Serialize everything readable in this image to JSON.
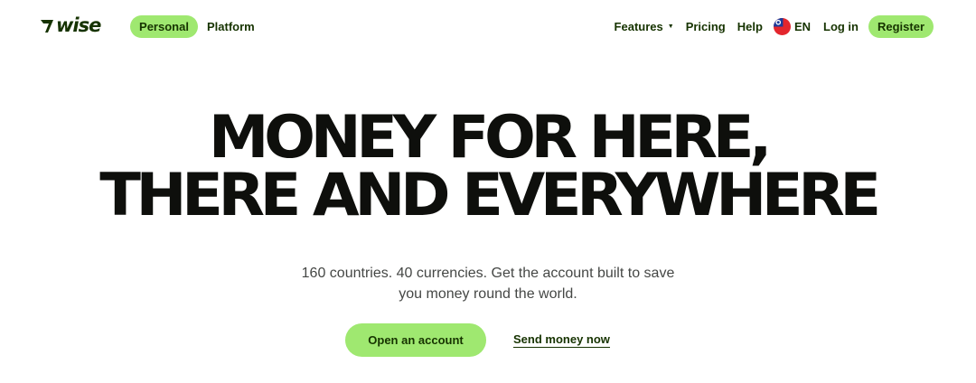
{
  "brand": {
    "logo_text": "wise"
  },
  "nav": {
    "tabs": [
      {
        "label": "Personal",
        "active": true
      },
      {
        "label": "Platform",
        "active": false
      }
    ],
    "features_label": "Features",
    "pricing_label": "Pricing",
    "help_label": "Help",
    "language_code": "EN",
    "login_label": "Log in",
    "register_label": "Register"
  },
  "hero": {
    "headline_line1": "MONEY FOR HERE,",
    "headline_line2": "THERE AND EVERYWHERE",
    "sub_line1": "160 countries. 40 currencies. Get the account built to save",
    "sub_line2": "you money round the world.",
    "primary_cta": "Open an account",
    "secondary_cta": "Send money now"
  },
  "colors": {
    "accent": "#9fe870",
    "brand_dark": "#163300",
    "text": "#0e0f0c",
    "muted": "#454745"
  },
  "icons": {
    "logo": "wise-flag-logo",
    "dropdown": "chevron-down-icon",
    "language": "taiwan-flag-icon"
  }
}
